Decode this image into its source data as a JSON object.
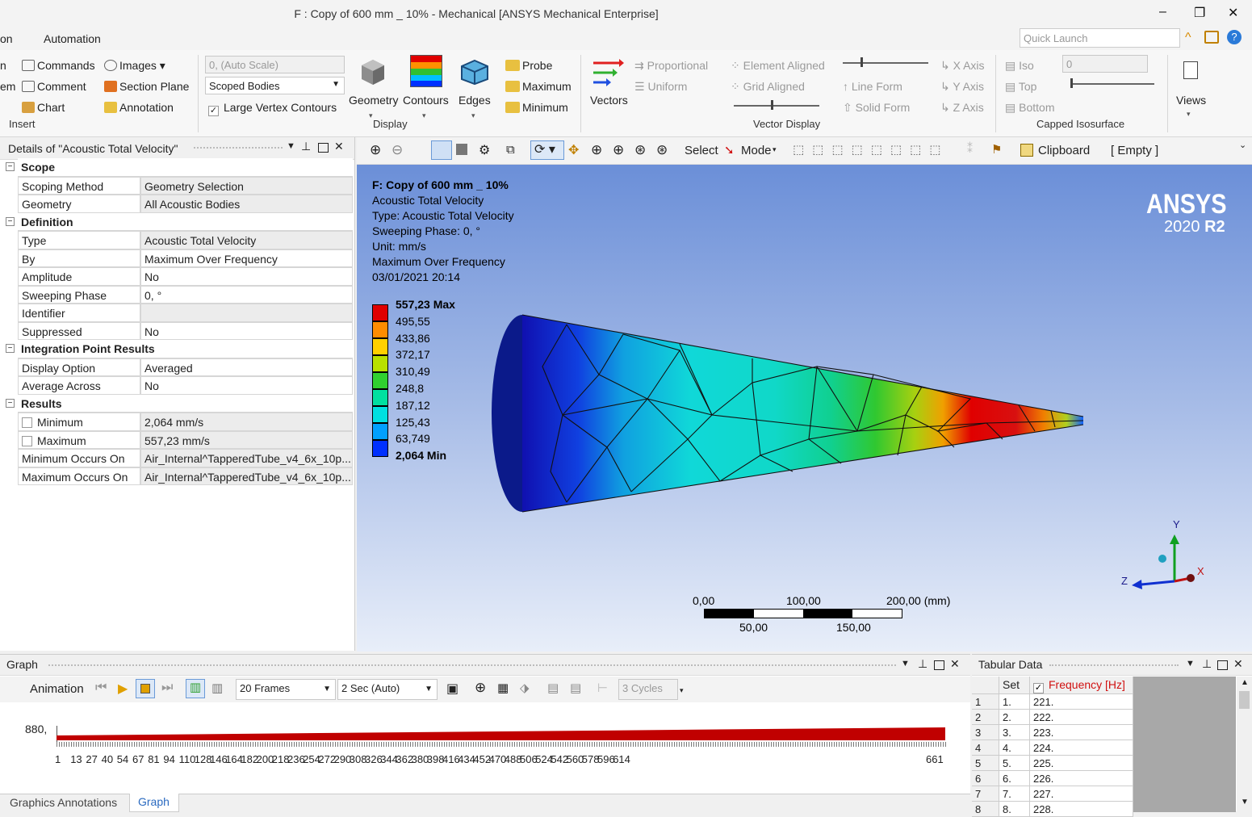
{
  "window": {
    "title": "F : Copy of 600 mm _ 10% - Mechanical [ANSYS Mechanical Enterprise]",
    "minimize": "–",
    "restore": "❐",
    "close": "✕"
  },
  "menu": {
    "partial_tab": "on",
    "automation": "Automation"
  },
  "quick_launch": {
    "placeholder": "Quick Launch"
  },
  "ribbon": {
    "insert": {
      "partial_top": "n",
      "partial_mid": "em",
      "commands": "Commands",
      "comment": "Comment",
      "chart": "Chart",
      "images": "Images",
      "section_plane": "Section Plane",
      "annotation": "Annotation",
      "group": "Insert"
    },
    "display": {
      "scale_combo": "0, (Auto Scale)",
      "scoped_combo": "Scoped Bodies",
      "large_vertex": "Large Vertex Contours",
      "geometry": "Geometry",
      "contours": "Contours",
      "edges": "Edges",
      "probe": "Probe",
      "maximum": "Maximum",
      "minimum": "Minimum",
      "group": "Display"
    },
    "vector": {
      "vectors": "Vectors",
      "proportional": "Proportional",
      "uniform": "Uniform",
      "element_aligned": "Element Aligned",
      "grid_aligned": "Grid Aligned",
      "line_form": "Line Form",
      "solid_form": "Solid Form",
      "group": "Vector Display"
    },
    "capped": {
      "x_axis": "X Axis",
      "y_axis": "Y Axis",
      "z_axis": "Z Axis",
      "iso": "Iso",
      "top": "Top",
      "bottom": "Bottom",
      "value": "0",
      "group": "Capped Isosurface"
    },
    "views": "Views"
  },
  "details": {
    "header": "Details of \"Acoustic Total Velocity\"",
    "rows": [
      {
        "type": "cat",
        "key": "Scope"
      },
      {
        "key": "Scoping Method",
        "value": "Geometry Selection",
        "grey": true
      },
      {
        "key": "Geometry",
        "value": "All Acoustic Bodies",
        "grey": true
      },
      {
        "type": "cat",
        "key": "Definition"
      },
      {
        "key": "Type",
        "value": "Acoustic Total Velocity",
        "grey": true
      },
      {
        "key": "By",
        "value": "Maximum Over Frequency"
      },
      {
        "key": "Amplitude",
        "value": "No"
      },
      {
        "key": "Sweeping Phase",
        "value": "0, °"
      },
      {
        "key": "Identifier",
        "value": "",
        "grey": true
      },
      {
        "key": "Suppressed",
        "value": "No"
      },
      {
        "type": "cat",
        "key": "Integration Point Results"
      },
      {
        "key": "Display Option",
        "value": "Averaged"
      },
      {
        "key": "Average Across Bodies",
        "value": "No"
      },
      {
        "type": "cat",
        "key": "Results"
      },
      {
        "key": "Minimum",
        "value": "2,064 mm/s",
        "grey": true,
        "check": true
      },
      {
        "key": "Maximum",
        "value": "557,23 mm/s",
        "grey": true,
        "check": true
      },
      {
        "key": "Minimum Occurs On",
        "value": "Air_Internal^TapperedTube_v4_6x_10p...",
        "grey": true
      },
      {
        "key": "Maximum Occurs On",
        "value": "Air_Internal^TapperedTube_v4_6x_10p...",
        "grey": true
      }
    ]
  },
  "vp_toolbar": {
    "select": "Select",
    "mode": "Mode",
    "clipboard": "Clipboard",
    "empty": "[ Empty ]"
  },
  "viewport": {
    "info": [
      "F: Copy of 600 mm _ 10%",
      "Acoustic Total Velocity",
      "Type: Acoustic Total Velocity",
      "Sweeping Phase: 0, °",
      "Unit: mm/s",
      "Maximum Over Frequency",
      "03/01/2021 20:14"
    ],
    "legend": [
      "557,23 Max",
      "495,55",
      "433,86",
      "372,17",
      "310,49",
      "248,8",
      "187,12",
      "125,43",
      "63,749",
      "2,064 Min"
    ],
    "legend_colors": [
      "#e00000",
      "#ff8c00",
      "#ffd000",
      "#b8e000",
      "#30d030",
      "#00e0a0",
      "#00e0e0",
      "#00a0ff",
      "#0030ff"
    ],
    "brand": "ANSYS",
    "version_num": "2020",
    "version_rel": "R2",
    "scale_top": [
      "0,00",
      "100,00",
      "200,00 (mm)"
    ],
    "scale_bottom": [
      "50,00",
      "150,00"
    ],
    "axes": {
      "x": "X",
      "y": "Y",
      "z": "Z"
    }
  },
  "graph": {
    "title": "Graph",
    "animation": "Animation",
    "frames": "20 Frames",
    "duration": "2 Sec (Auto)",
    "cycles": "3 Cycles",
    "y_value": "880,",
    "x_ticks": [
      "1",
      "13",
      "27",
      "40",
      "54",
      "67",
      "81",
      "94",
      "110",
      "128",
      "146",
      "164",
      "182",
      "200",
      "218",
      "236",
      "254",
      "272",
      "290",
      "308",
      "326",
      "344",
      "362",
      "380",
      "398",
      "416",
      "434",
      "452",
      "470",
      "488",
      "506",
      "524",
      "542",
      "560",
      "578",
      "596",
      "614",
      "661"
    ],
    "tabs": [
      "Graphics Annotations",
      "Graph"
    ]
  },
  "tabular": {
    "title": "Tabular Data",
    "col_set": "Set",
    "col_freq": "Frequency [Hz]",
    "rows": [
      {
        "n": "1",
        "set": "1.",
        "f": "221."
      },
      {
        "n": "2",
        "set": "2.",
        "f": "222."
      },
      {
        "n": "3",
        "set": "3.",
        "f": "223."
      },
      {
        "n": "4",
        "set": "4.",
        "f": "224."
      },
      {
        "n": "5",
        "set": "5.",
        "f": "225."
      },
      {
        "n": "6",
        "set": "6.",
        "f": "226."
      },
      {
        "n": "7",
        "set": "7.",
        "f": "227."
      },
      {
        "n": "8",
        "set": "8.",
        "f": "228."
      }
    ]
  }
}
